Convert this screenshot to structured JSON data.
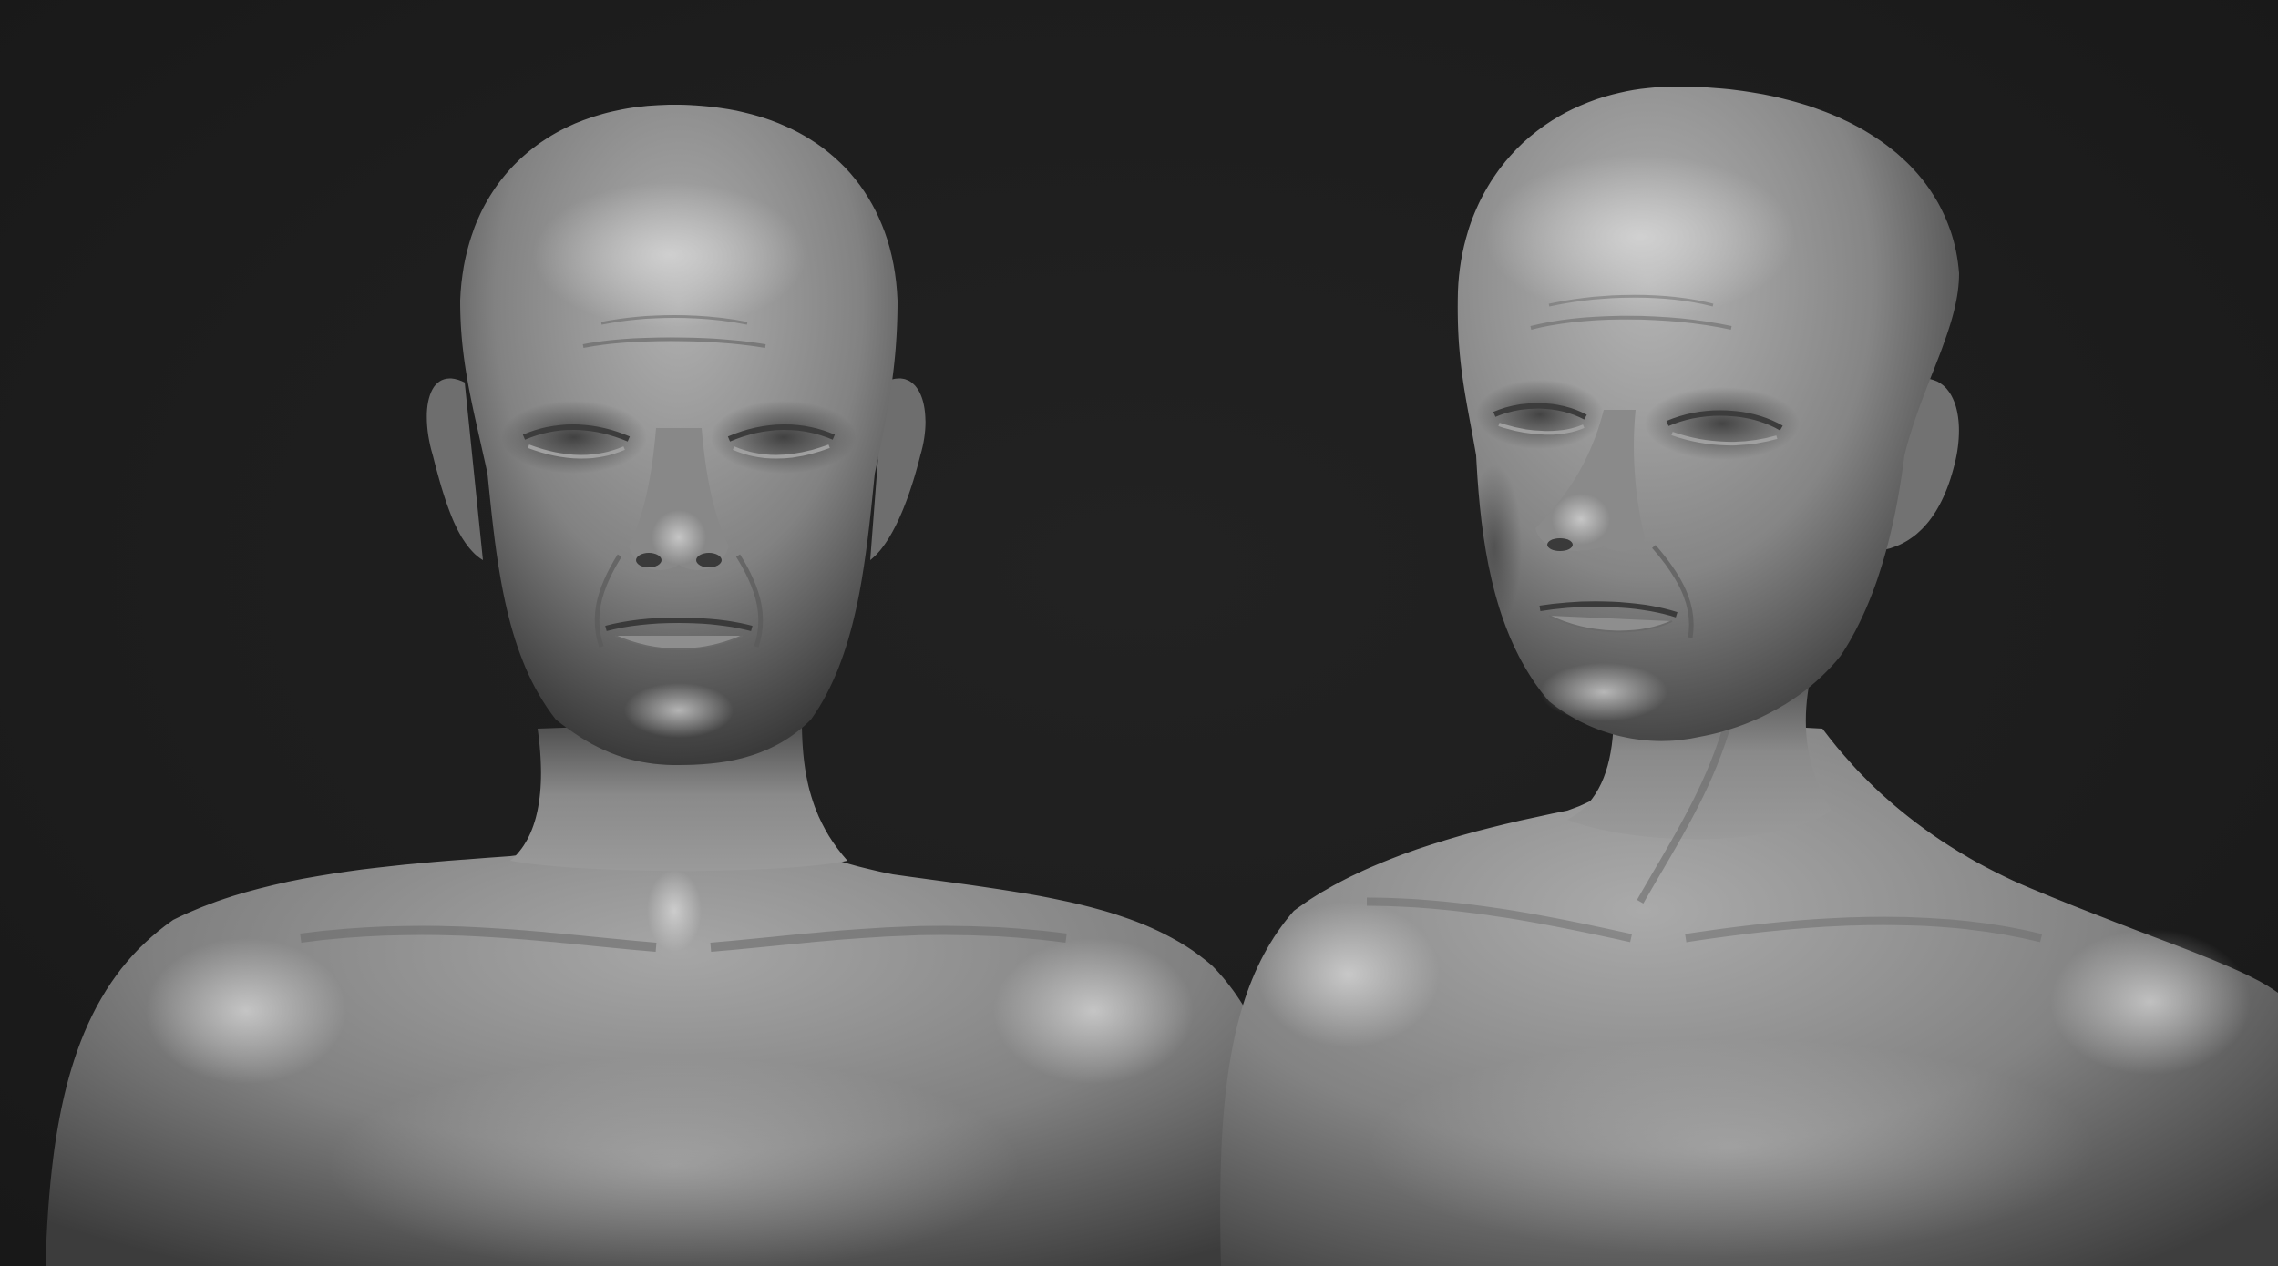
{
  "scene": {
    "background_color": "#1c1c1c",
    "clay_color": "#8c8c8c",
    "highlight_color": "#d4d4d4",
    "shadow_color": "#2e2e2e",
    "figures": [
      {
        "name": "front-view-bust",
        "icon": "sculpt-bust-front"
      },
      {
        "name": "three-quarter-view-bust",
        "icon": "sculpt-bust-three-quarter"
      }
    ]
  }
}
